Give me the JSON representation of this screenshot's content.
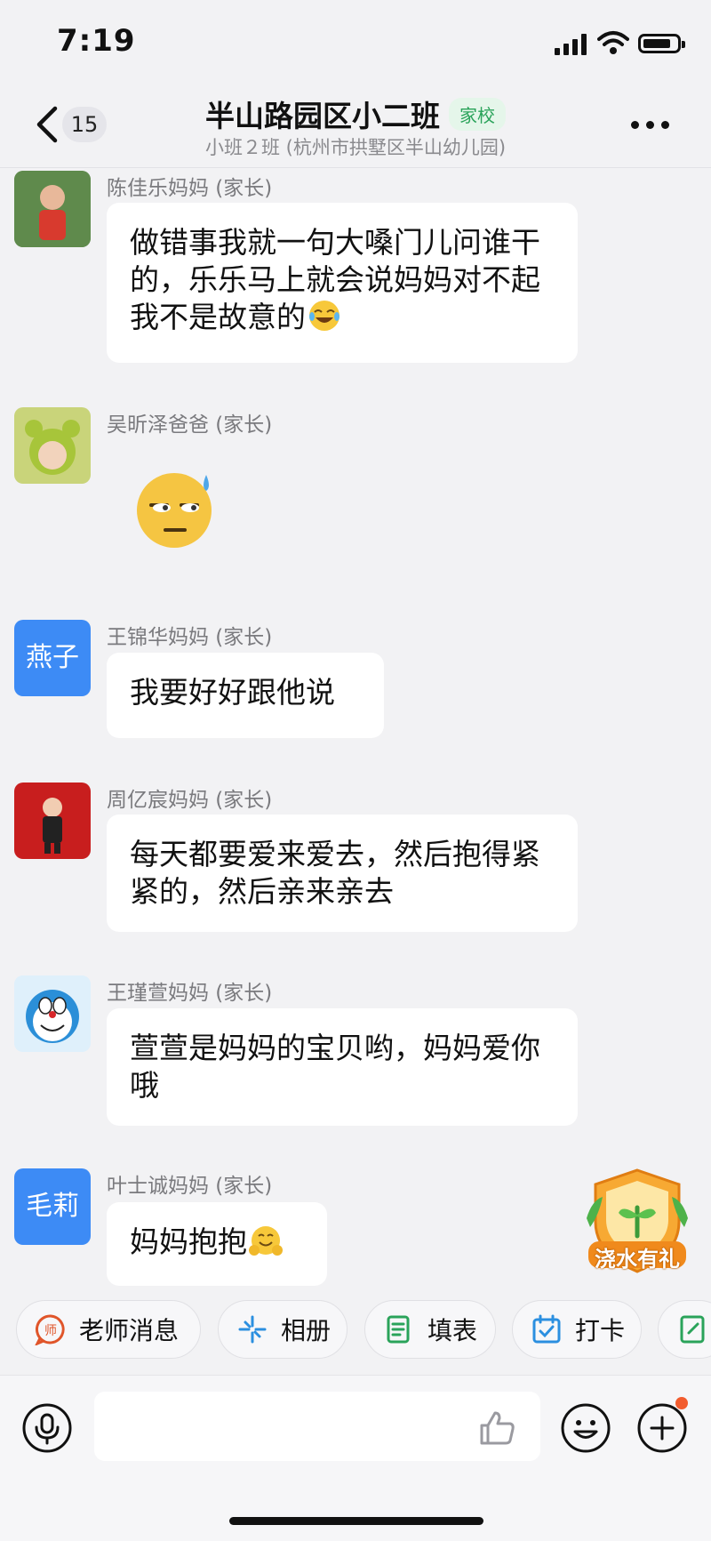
{
  "status_bar": {
    "time": "7:19"
  },
  "header": {
    "unread_count": "15",
    "title": "半山路园区小二班",
    "tag": "家校",
    "subtitle": "小班２班 (杭州市拱墅区半山幼儿园)"
  },
  "messages": [
    {
      "sender": "陈佳乐妈妈 (家长)",
      "text": "做错事我就一句大嗓门儿问谁干的，乐乐马上就会说妈妈对不起我不是故意的",
      "emoji": "tears-of-joy"
    },
    {
      "sender": "吴昕泽爸爸 (家长)",
      "sticker": "sweat-unamused-face"
    },
    {
      "sender": "王锦华妈妈 (家长)",
      "avatar_text": "燕子",
      "text": "我要好好跟他说"
    },
    {
      "sender": "周亿宸妈妈 (家长)",
      "text": "每天都要爱来爱去，然后抱得紧紧的，然后亲来亲去"
    },
    {
      "sender": "王瑾萱妈妈 (家长)",
      "text": "萱萱是妈妈的宝贝哟，妈妈爱你哦"
    },
    {
      "sender": "叶士诚妈妈 (家长)",
      "avatar_text": "毛莉",
      "text": "妈妈抱抱",
      "emoji": "hugging-face"
    }
  ],
  "reward_badge": {
    "label": "浇水有礼"
  },
  "quick_actions": [
    {
      "label": "老师消息",
      "icon": "teacher-icon"
    },
    {
      "label": "相册",
      "icon": "album-icon"
    },
    {
      "label": "填表",
      "icon": "form-icon"
    },
    {
      "label": "打卡",
      "icon": "checkin-icon"
    }
  ],
  "input": {
    "placeholder": ""
  },
  "colors": {
    "accent_blue": "#3d8bf5",
    "tag_green": "#2aa35a",
    "notify_dot": "#f25c2e"
  }
}
